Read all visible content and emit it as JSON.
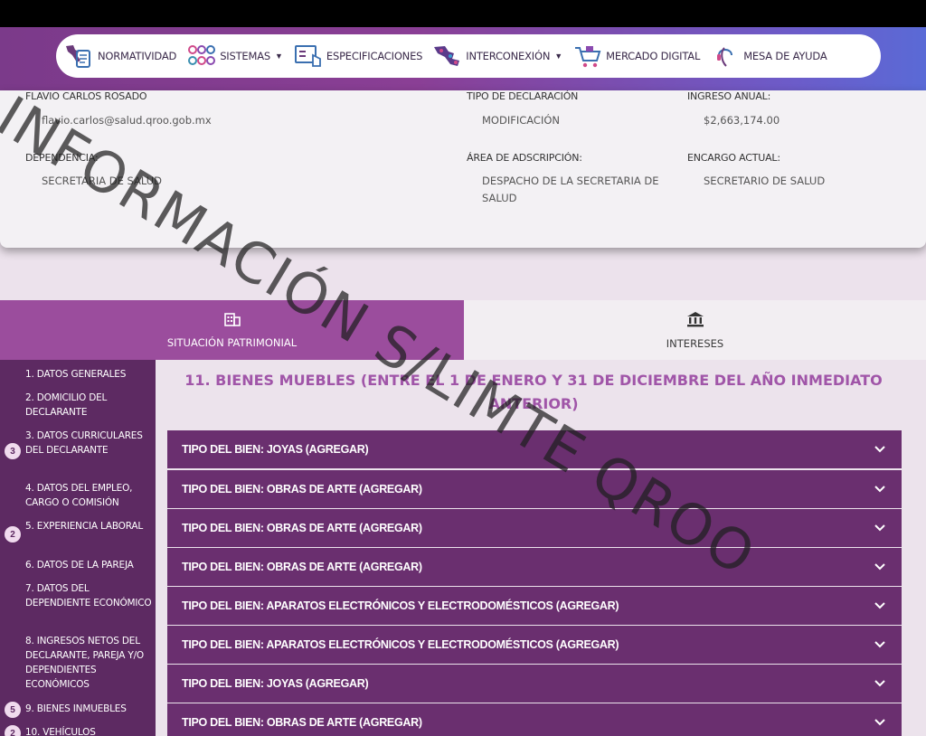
{
  "nav": {
    "items": [
      {
        "label": "NORMATIVIDAD",
        "icon": "document-mexico-icon",
        "caret": false
      },
      {
        "label": "SISTEMAS",
        "icon": "circles-grid-icon",
        "caret": true
      },
      {
        "label": "ESPECIFICACIONES",
        "icon": "specs-touch-icon",
        "caret": false
      },
      {
        "label": "INTERCONEXIÓN",
        "icon": "map-mexico-icon",
        "caret": true
      },
      {
        "label": "MERCADO DIGITAL",
        "icon": "cart-icon",
        "caret": false
      },
      {
        "label": "MESA DE AYUDA",
        "icon": "headset-icon",
        "caret": false
      }
    ]
  },
  "declarant": {
    "name": "FLAVIO CARLOS ROSADO",
    "email": "flavio.carlos@salud.qroo.gob.mx",
    "tipo_label": "TIPO DE DECLARACIÓN",
    "tipo_value": "MODIFICACIÓN",
    "ingreso_label": "INGRESO ANUAL:",
    "ingreso_value": "$2,663,174.00",
    "dependencia_label": "DEPENDENCIA:",
    "dependencia_value": "SECRETARIA DE SALUD",
    "area_label": "ÁREA DE ADSCRIPCIÓN:",
    "area_value_1": "DESPACHO DE LA SECRETARIA DE",
    "area_value_2": "SALUD",
    "encargo_label": "ENCARGO ACTUAL:",
    "encargo_value": "SECRETARIO DE SALUD"
  },
  "tabs": {
    "left": {
      "label": "SITUACIÓN PATRIMONIAL",
      "icon": "building-icon"
    },
    "right": {
      "label": "INTERESES",
      "icon": "bank-icon"
    }
  },
  "sidebar": {
    "items": [
      {
        "label": "1. DATOS GENERALES",
        "badge": ""
      },
      {
        "label": "2. DOMICILIO DEL DECLARANTE",
        "badge": ""
      },
      {
        "label": "3. DATOS CURRICULARES DEL DECLARANTE",
        "badge": "3"
      },
      {
        "label": "4. DATOS DEL EMPLEO, CARGO O COMISIÓN",
        "badge": ""
      },
      {
        "label": "5. EXPERIENCIA LABORAL",
        "badge": "2"
      },
      {
        "label": "6. DATOS DE LA PAREJA",
        "badge": ""
      },
      {
        "label": "7. DATOS DEL DEPENDIENTE ECONÓMICO",
        "badge": ""
      },
      {
        "label": "8. INGRESOS NETOS DEL DECLARANTE, PAREJA Y/O DEPENDIENTES ECONÓMICOS",
        "badge": ""
      },
      {
        "label": "9. BIENES INMUEBLES",
        "badge": "5"
      },
      {
        "label": "10. VEHÍCULOS",
        "badge": "2"
      }
    ]
  },
  "section": {
    "title_line1": "11. BIENES MUEBLES (ENTRE EL 1 DE ENERO Y 31 DE DICIEMBRE DEL AÑO INMEDIATO",
    "title_line2": "ANTERIOR)"
  },
  "accordion": [
    "TIPO DEL BIEN: JOYAS (AGREGAR)",
    "TIPO DEL BIEN: OBRAS DE ARTE (AGREGAR)",
    "TIPO DEL BIEN: OBRAS DE ARTE (AGREGAR)",
    "TIPO DEL BIEN: OBRAS DE ARTE (AGREGAR)",
    "TIPO DEL BIEN: APARATOS ELECTRÓNICOS Y ELECTRODOMÉSTICOS (AGREGAR)",
    "TIPO DEL BIEN: APARATOS ELECTRÓNICOS Y ELECTRODOMÉSTICOS (AGREGAR)",
    "TIPO DEL BIEN: JOYAS (AGREGAR)",
    "TIPO DEL BIEN: OBRAS DE ARTE (AGREGAR)"
  ],
  "watermark": {
    "line1": "INFORMACIÓN S/LIMTE QROO"
  }
}
